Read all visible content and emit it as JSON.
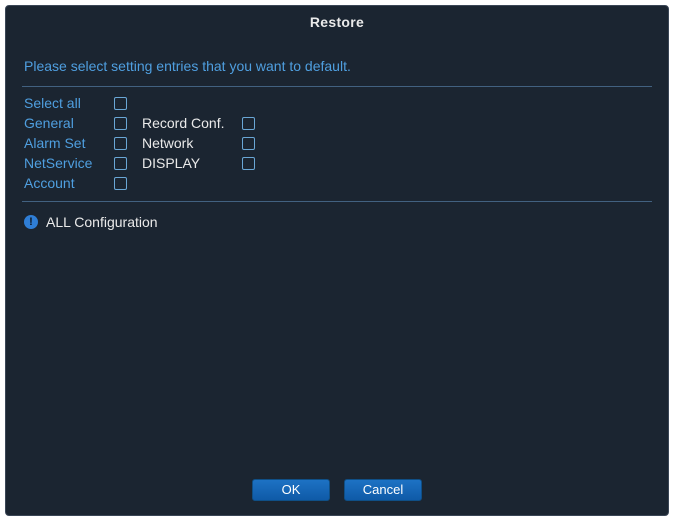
{
  "title": "Restore",
  "instruction": "Please select setting entries that you want to default.",
  "options": {
    "select_all": {
      "label": "Select all",
      "checked": false
    },
    "general": {
      "label": "General",
      "checked": false
    },
    "record_conf": {
      "label": "Record Conf.",
      "checked": false
    },
    "alarm_set": {
      "label": "Alarm Set",
      "checked": false
    },
    "network": {
      "label": "Network",
      "checked": false
    },
    "netservice": {
      "label": "NetService",
      "checked": false
    },
    "display": {
      "label": "DISPLAY",
      "checked": false
    },
    "account": {
      "label": "Account",
      "checked": false
    }
  },
  "info_text": "ALL Configuration",
  "buttons": {
    "ok": "OK",
    "cancel": "Cancel"
  }
}
